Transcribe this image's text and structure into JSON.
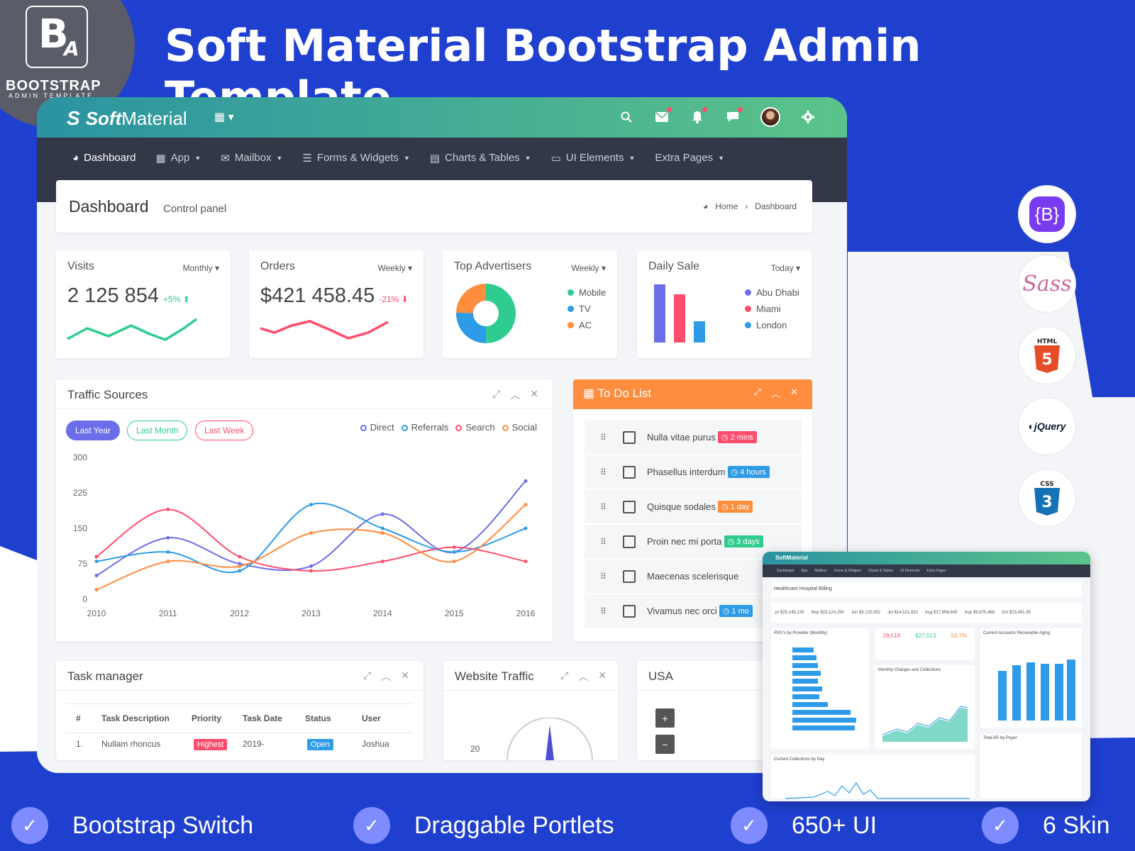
{
  "brand": {
    "letters": "BA",
    "title": "BOOTSTRAP",
    "subtitle": "ADMIN TEMPLATE"
  },
  "hero_title": "Soft Material Bootstrap Admin Template",
  "app": {
    "logo_bold": "Soft",
    "logo_rest": "Material",
    "nav": [
      {
        "label": "Dashboard",
        "icon": "dashboard-icon"
      },
      {
        "label": "App",
        "icon": "grid-icon"
      },
      {
        "label": "Mailbox",
        "icon": "envelope-icon"
      },
      {
        "label": "Forms & Widgets",
        "icon": "list-icon"
      },
      {
        "label": "Charts & Tables",
        "icon": "table-icon"
      },
      {
        "label": "UI Elements",
        "icon": "laptop-icon"
      },
      {
        "label": "Extra Pages",
        "icon": ""
      }
    ],
    "page_title": "Dashboard",
    "page_subtitle": "Control panel",
    "breadcrumb": [
      "Home",
      "Dashboard"
    ]
  },
  "stats": {
    "visits": {
      "title": "Visits",
      "period": "Monthly",
      "value": "2 125 854",
      "change": "+5%"
    },
    "orders": {
      "title": "Orders",
      "period": "Weekly",
      "value": "$421 458.45",
      "change": "-21%"
    },
    "advertisers": {
      "title": "Top Advertisers",
      "period": "Weekly",
      "legend": [
        "Mobile",
        "TV",
        "AC"
      ]
    },
    "daily_sale": {
      "title": "Daily Sale",
      "period": "Today",
      "legend": [
        "Abu Dhabi",
        "Miami",
        "London"
      ]
    }
  },
  "colors": {
    "purple": "#6b6ee8",
    "red": "#ff4d6d",
    "blue": "#2e9be8",
    "orange": "#fe8d3e",
    "green": "#2ecc8f"
  },
  "traffic": {
    "title": "Traffic Sources",
    "pills": [
      "Last Year",
      "Last Month",
      "Last Week"
    ],
    "legend": [
      "Direct",
      "Referrals",
      "Search",
      "Social"
    ]
  },
  "chart_data": {
    "type": "line",
    "x": [
      "2010",
      "2011",
      "2012",
      "2013",
      "2014",
      "2015",
      "2016"
    ],
    "ylim": [
      0,
      300
    ],
    "yticks": [
      "0",
      "75",
      "150",
      "225",
      "300"
    ],
    "series": [
      {
        "name": "Direct",
        "color": "#6b6ee8",
        "values": [
          50,
          130,
          75,
          70,
          180,
          100,
          250
        ]
      },
      {
        "name": "Referrals",
        "color": "#2e9be8",
        "values": [
          80,
          100,
          60,
          200,
          150,
          100,
          150
        ]
      },
      {
        "name": "Search",
        "color": "#ff4d6d",
        "values": [
          90,
          190,
          90,
          60,
          80,
          110,
          80
        ]
      },
      {
        "name": "Social",
        "color": "#fe8d3e",
        "values": [
          20,
          80,
          70,
          140,
          140,
          80,
          200
        ]
      }
    ]
  },
  "todo": {
    "title": "To Do List",
    "items": [
      {
        "text": "Nulla vitae purus",
        "badge": "2 mins",
        "color": "#ff4d6d"
      },
      {
        "text": "Phasellus interdum",
        "badge": "4 hours",
        "color": "#2e9be8"
      },
      {
        "text": "Quisque sodales",
        "badge": "1 day",
        "color": "#fe8d3e"
      },
      {
        "text": "Proin nec mi porta",
        "badge": "3 days",
        "color": "#2ecc8f"
      },
      {
        "text": "Maecenas scelerisque",
        "badge": "",
        "color": "#6b6ee8"
      },
      {
        "text": "Vivamus nec orci",
        "badge": "1 mo",
        "color": "#2e9be8"
      }
    ]
  },
  "task_manager": {
    "title": "Task manager",
    "columns": [
      "#",
      "Task Description",
      "Priority",
      "Task Date",
      "Status",
      "User"
    ],
    "row": [
      "1.",
      "Nullam rhoncus",
      "Highest",
      "2019-",
      "Open",
      "Joshua"
    ]
  },
  "website_traffic": {
    "title": "Website Traffic",
    "tick": "20"
  },
  "usa": {
    "title": "USA",
    "zoom_in": "+",
    "zoom_out": "−"
  },
  "mini": {
    "logo": "SoftMaterial",
    "title": "Healthcare Hospital Billing",
    "kpis": [
      "pr $25,145,126",
      "May $10,124,250",
      "Jun $3,125,952",
      "Jul $14,521,832",
      "Aug $17,656,845",
      "Sup $5,875,488",
      "Oct $23,451,95"
    ],
    "tiles": [
      "29,518",
      "$27,513",
      "53.7%"
    ],
    "cards": [
      "RVU's by Provider (Monthly)",
      "Monthly Charges and Collections",
      "Current Accounts Receivable Aging",
      "Current Collections by Day",
      "Total AR by Payer"
    ]
  },
  "features": [
    "Bootstrap Switch",
    "Draggable Portlets",
    "650+ UI",
    "6 Skin"
  ]
}
